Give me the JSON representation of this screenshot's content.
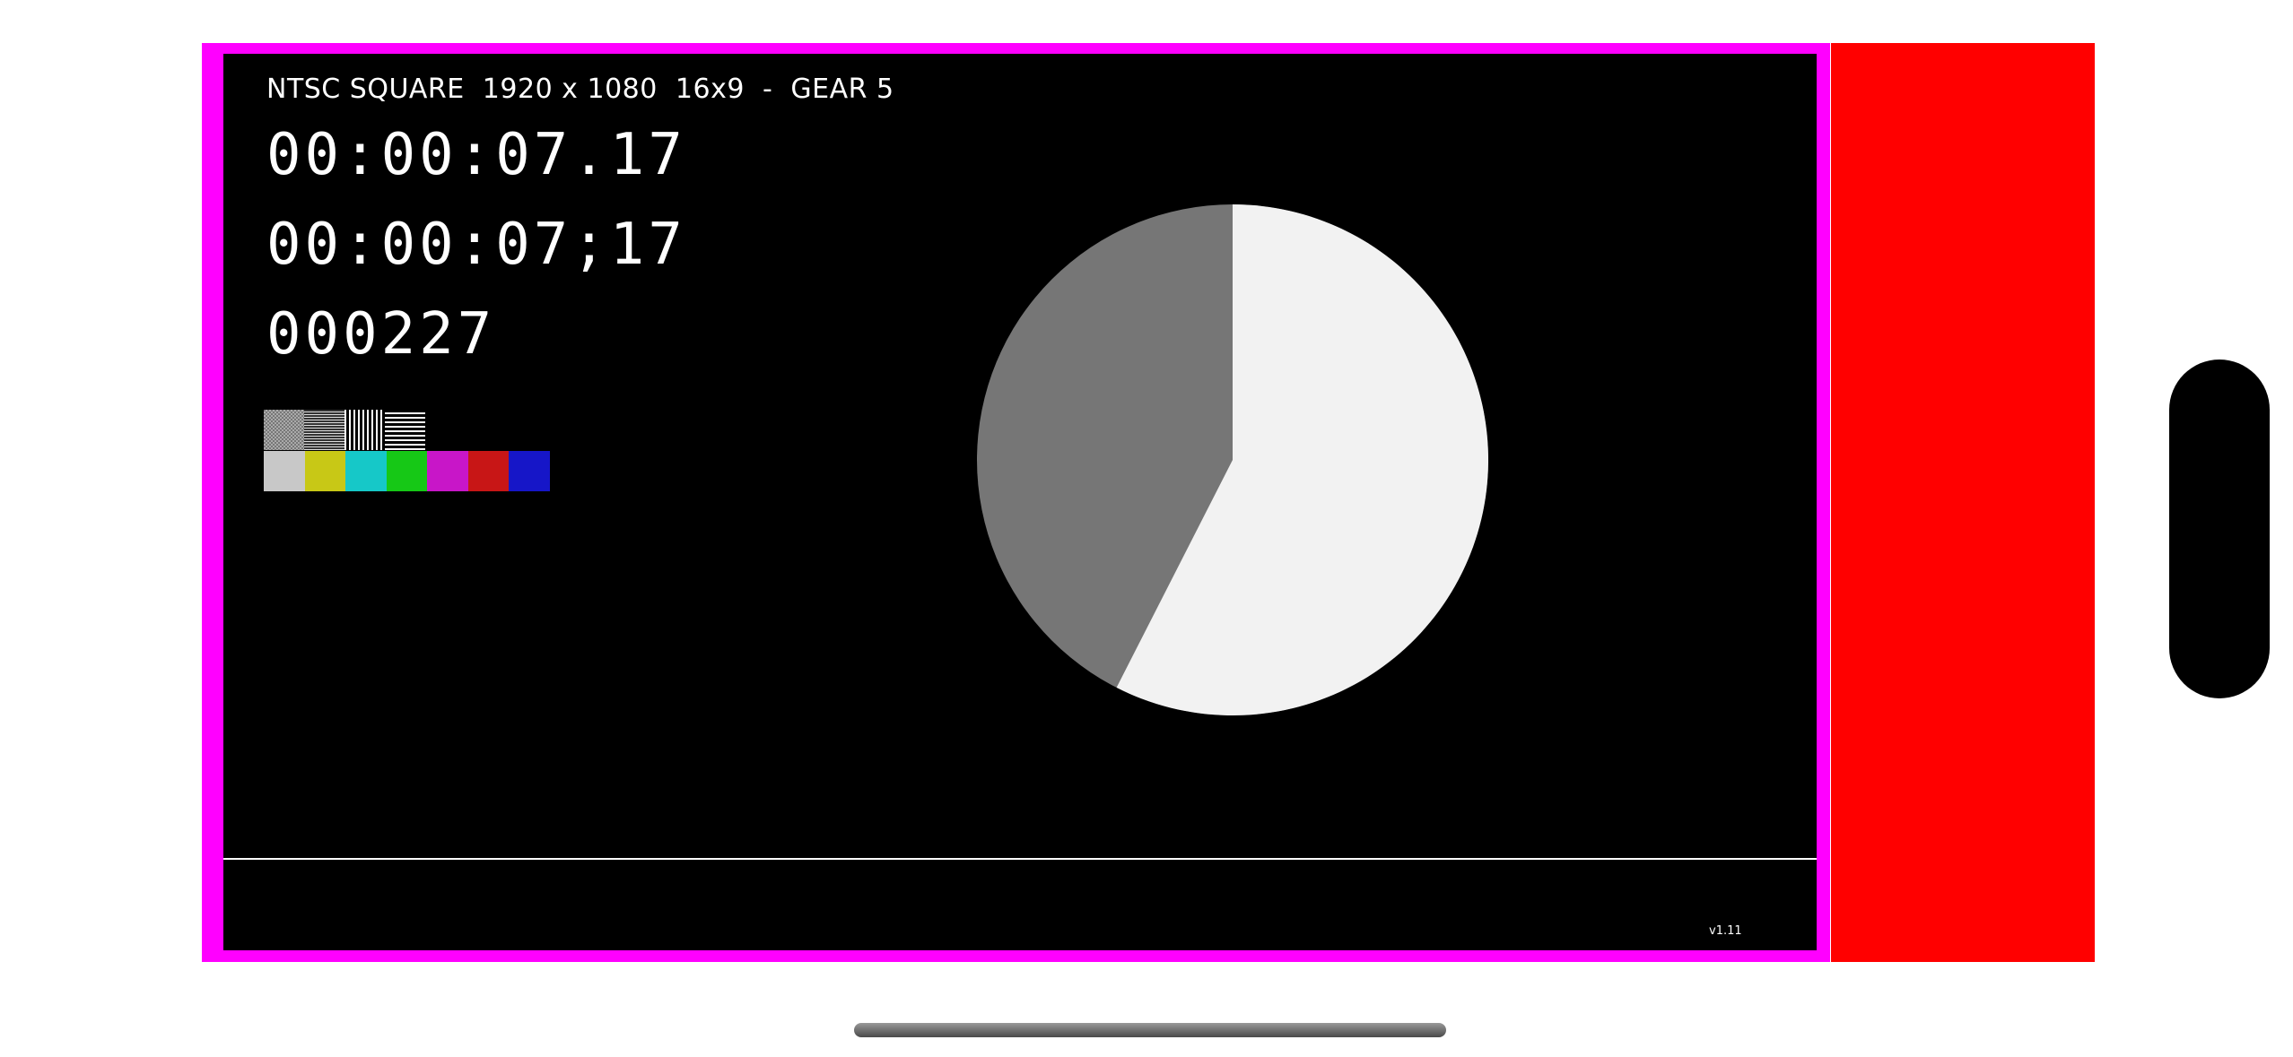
{
  "screen": {
    "title": "NTSC SQUARE  1920 x 1080  16x9  -  GEAR 5",
    "timecode_dot": "00:00:07.17",
    "timecode_semicolon": "00:00:07;17",
    "frame_count": "000227",
    "version": "v1.11"
  },
  "test_patterns": [
    "checkerboard-pattern",
    "horizontal-fine-lines-pattern",
    "vertical-lines-pattern",
    "horizontal-lines-pattern"
  ],
  "color_bars": [
    "#c8c8c8",
    "#c8c816",
    "#16c8c8",
    "#16c816",
    "#c816c8",
    "#c81616",
    "#1616c8"
  ],
  "pie": {
    "progress_fraction": 0.575,
    "filled_color": "#f2f2f2",
    "remaining_color": "#767676"
  },
  "colors": {
    "frame_border": "#ff00ff",
    "side_bar": "#ff0000",
    "background": "#000000"
  }
}
